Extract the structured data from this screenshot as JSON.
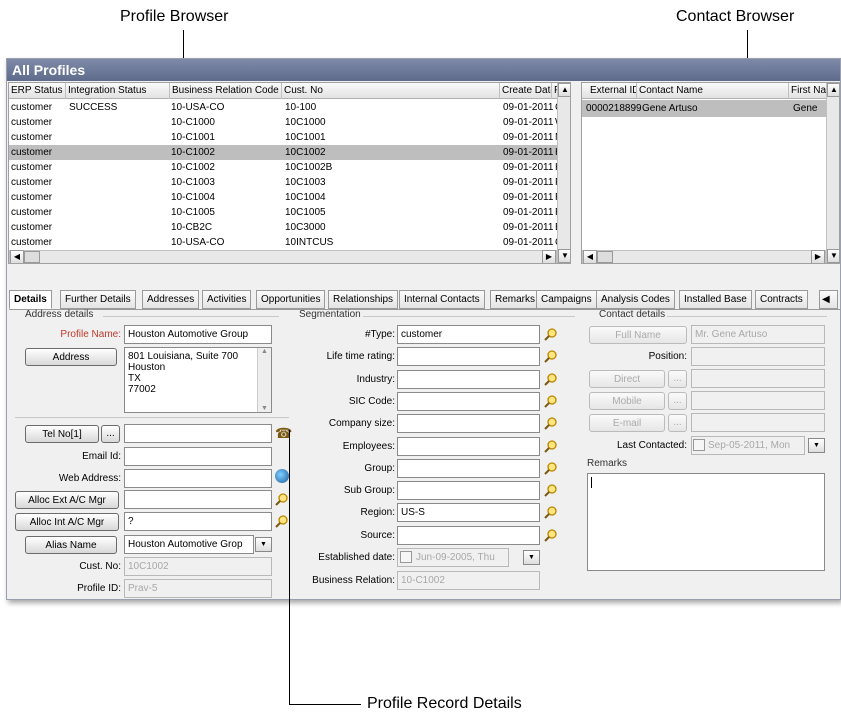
{
  "callouts": {
    "profile_browser": "Profile Browser",
    "contact_browser": "Contact Browser",
    "profile_record_details": "Profile Record Details"
  },
  "window": {
    "title": "All Profiles"
  },
  "profiles_grid": {
    "columns": [
      "ERP Status",
      "Integration Status",
      "Business Relation Code",
      "Cust. No",
      "Create Date",
      "P"
    ],
    "rows": [
      [
        "customer",
        "SUCCESS",
        "10-USA-CO",
        "10-100",
        "09-01-2011",
        "C"
      ],
      [
        "customer",
        "",
        "10-C1000",
        "10C1000",
        "09-01-2011",
        "W"
      ],
      [
        "customer",
        "",
        "10-C1001",
        "10C1001",
        "09-01-2011",
        "M"
      ],
      [
        "customer",
        "",
        "10-C1002",
        "10C1002",
        "09-01-2011",
        "H"
      ],
      [
        "customer",
        "",
        "10-C1002",
        "10C1002B",
        "09-01-2011",
        "H"
      ],
      [
        "customer",
        "",
        "10-C1003",
        "10C1003",
        "09-01-2011",
        "P"
      ],
      [
        "customer",
        "",
        "10-C1004",
        "10C1004",
        "09-01-2011",
        "P"
      ],
      [
        "customer",
        "",
        "10-C1005",
        "10C1005",
        "09-01-2011",
        "R"
      ],
      [
        "customer",
        "",
        "10-CB2C",
        "10C3000",
        "09-01-2011",
        "B"
      ],
      [
        "customer",
        "",
        "10-USA-CO",
        "10INTCUS",
        "09-01-2011",
        "C"
      ]
    ],
    "selected_row": 3
  },
  "contacts_grid": {
    "columns": [
      "External ID",
      "Contact Name",
      "First Nam"
    ],
    "rows": [
      [
        "0000218899",
        "Gene Artuso",
        "Gene"
      ]
    ]
  },
  "tabs": [
    "Details",
    "Further Details",
    "Addresses",
    "Activities",
    "Opportunities",
    "Relationships",
    "Internal Contacts",
    "Remarks",
    "Campaigns",
    "Analysis Codes",
    "Installed Base",
    "Contracts"
  ],
  "address_section": {
    "header": "Address details",
    "profile_name_label": "Profile Name:",
    "profile_name_value": "Houston Automotive Group",
    "address_button": "Address",
    "address_lines": [
      "801 Louisiana, Suite 700",
      "Houston",
      "TX",
      "77002"
    ],
    "tel_button": "Tel No[1]",
    "tel_value": "",
    "email_label": "Email Id:",
    "email_value": "",
    "web_label": "Web Address:",
    "web_value": "",
    "alloc_ext_button": "Alloc Ext A/C Mgr",
    "alloc_ext_value": "",
    "alloc_int_button": "Alloc Int A/C Mgr",
    "alloc_int_value": "?",
    "alias_button": "Alias Name",
    "alias_value": "Houston Automotive Grop",
    "cust_no_label": "Cust. No:",
    "cust_no_value": "10C1002",
    "profile_id_label": "Profile ID:",
    "profile_id_value": "Prav-5"
  },
  "segmentation": {
    "header": "Segmentation",
    "fields": [
      {
        "label": "#Type:",
        "value": "customer"
      },
      {
        "label": "Life time rating:",
        "value": ""
      },
      {
        "label": "Industry:",
        "value": ""
      },
      {
        "label": "SIC Code:",
        "value": ""
      },
      {
        "label": "Company size:",
        "value": ""
      },
      {
        "label": "Employees:",
        "value": ""
      },
      {
        "label": "Group:",
        "value": ""
      },
      {
        "label": "Sub Group:",
        "value": ""
      },
      {
        "label": "Region:",
        "value": "US-S"
      },
      {
        "label": "Source:",
        "value": ""
      }
    ],
    "established_label": "Established date:",
    "established_value": "Jun-09-2005, Thu",
    "business_relation_label": "Business Relation:",
    "business_relation_value": "10-C1002"
  },
  "contact_details": {
    "header": "Contact details",
    "full_name_button": "Full Name",
    "full_name_value": "Mr. Gene Artuso",
    "position_label": "Position:",
    "position_value": "",
    "direct_button": "Direct",
    "mobile_button": "Mobile",
    "email_button": "E-mail",
    "ellipsis": "...",
    "last_contacted_label": "Last Contacted:",
    "last_contacted_value": "Sep-05-2011, Mon",
    "remarks_label": "Remarks",
    "remarks_value": ""
  }
}
